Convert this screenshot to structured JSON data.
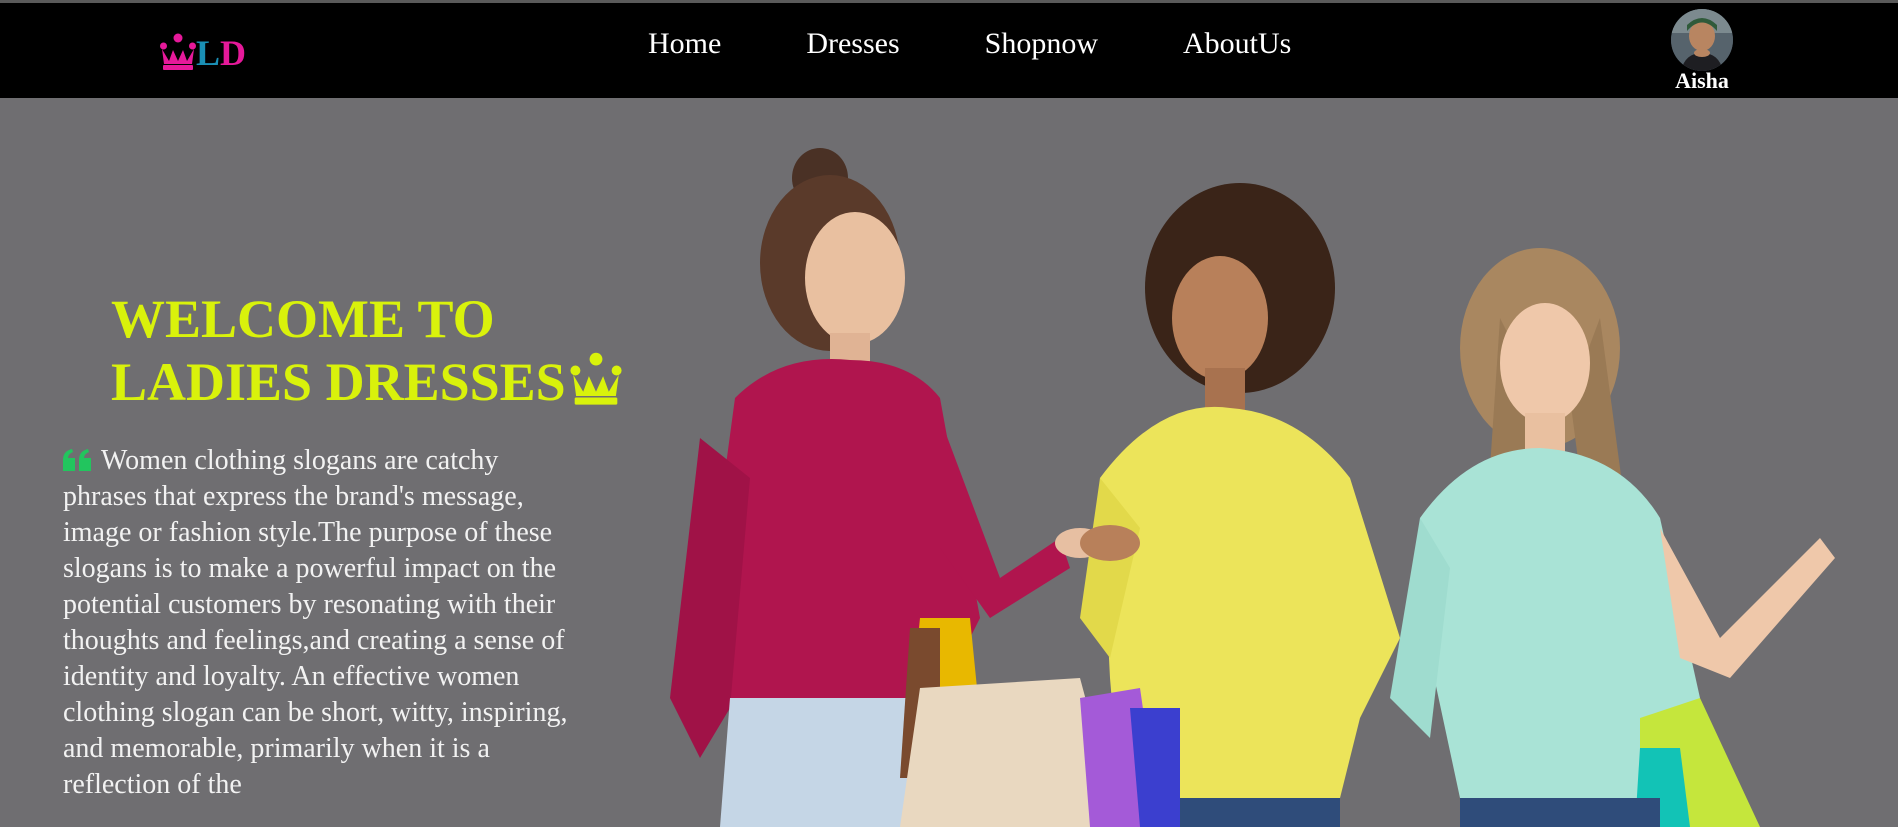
{
  "brand": {
    "logo_letters": "LD",
    "logo_icon": "crown-icon",
    "colors": {
      "crown": "#e6199a",
      "L": "#e6199a",
      "D": "#e6199a"
    }
  },
  "nav": {
    "items": [
      {
        "label": "Home"
      },
      {
        "label": "Dresses"
      },
      {
        "label": "Shopnow"
      },
      {
        "label": "AboutUs"
      }
    ]
  },
  "profile": {
    "name": "Aisha",
    "icon": "avatar"
  },
  "hero": {
    "title_line1": "WELCOME TO",
    "title_line2": "LADIES DRESSES",
    "title_icon": "crown-icon",
    "quote_icon": "quote-left-icon",
    "description": "Women clothing slogans are catchy phrases that express the brand's message, image or fashion style.The purpose of these slogans is to make a powerful impact on the potential customers by resonating with their thoughts and feelings,and creating a sense of identity and loyalty. An effective women clothing slogan can be short, witty, inspiring, and memorable, primarily when it is a reflection of the",
    "colors": {
      "background": "#6f6e71",
      "title": "#d9f20b",
      "quote_icon": "#22c55e",
      "text": "#f2f2f2"
    }
  }
}
